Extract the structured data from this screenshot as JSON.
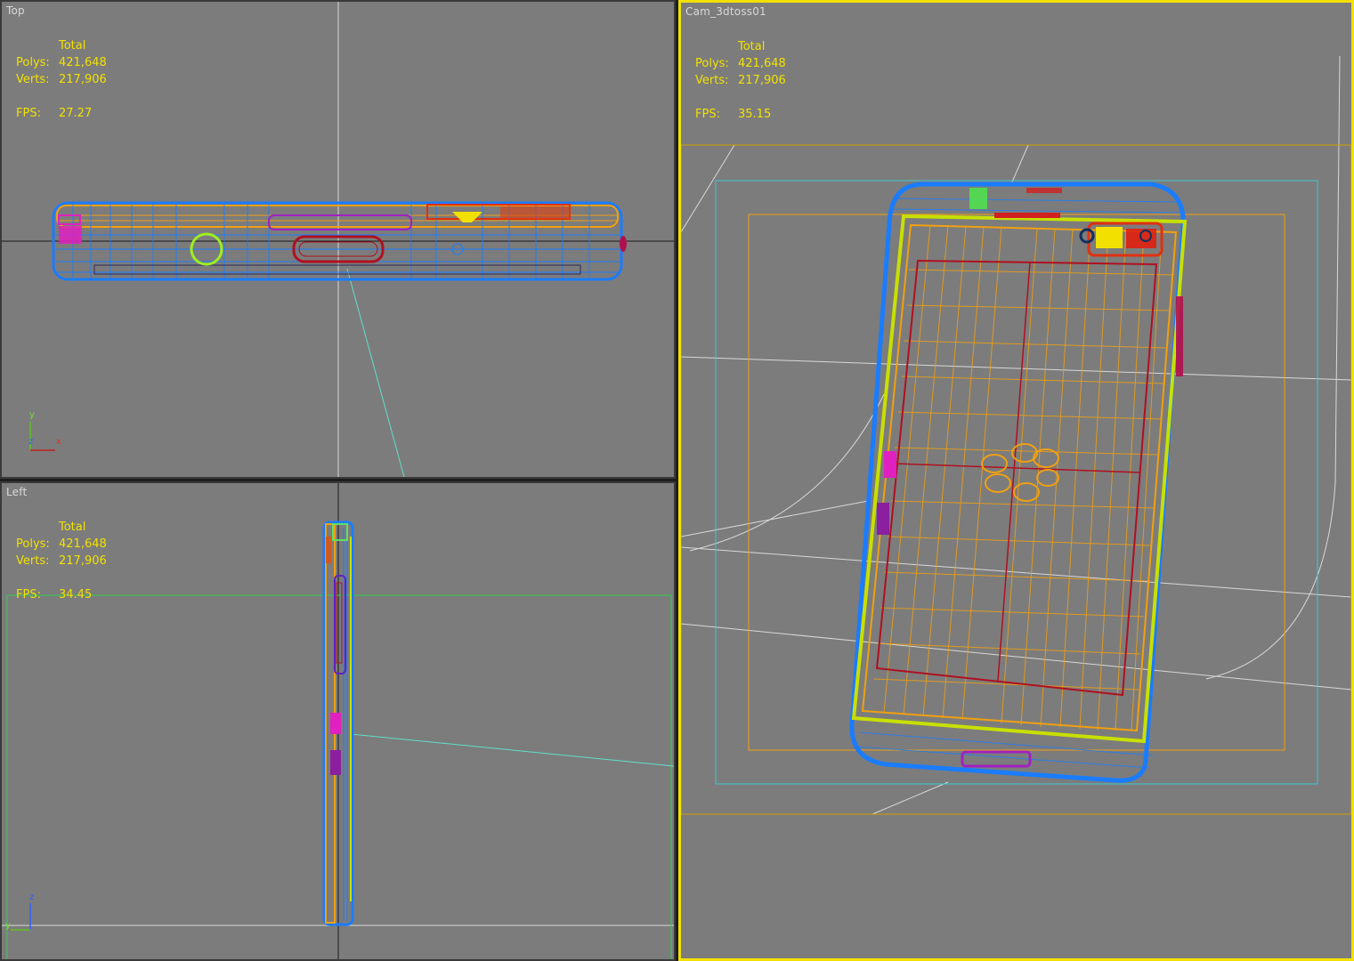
{
  "viewports": {
    "top": {
      "label": "Top",
      "stats": {
        "header": "Total",
        "polys_label": "Polys:",
        "polys": "421,648",
        "verts_label": "Verts:",
        "verts": "217,906",
        "fps_label": "FPS:",
        "fps": "27.27"
      },
      "tripod": {
        "up": "y",
        "mid": "z",
        "right": "x"
      }
    },
    "left": {
      "label": "Left",
      "stats": {
        "header": "Total",
        "polys_label": "Polys:",
        "polys": "421,648",
        "verts_label": "Verts:",
        "verts": "217,906",
        "fps_label": "FPS:",
        "fps": "34.45"
      },
      "tripod": {
        "up": "z",
        "mid": "y"
      }
    },
    "camera": {
      "label": "Cam_3dtoss01",
      "stats": {
        "header": "Total",
        "polys_label": "Polys:",
        "polys": "421,648",
        "verts_label": "Verts:",
        "verts": "217,906",
        "fps_label": "FPS:",
        "fps": "35.15"
      }
    }
  },
  "colors": {
    "viewport_bg": "#7c7c7c",
    "active_border": "#f2e100",
    "stats_text": "#f2e100",
    "wire_blue": "#1a7cff",
    "wire_orange": "#f0a010",
    "wire_yellow_green": "#c8e000",
    "wire_magenta": "#e020c0",
    "wire_red": "#b01020",
    "safe_frame_cyan": "#40c8d0",
    "grid_white": "#d8d8d8"
  }
}
